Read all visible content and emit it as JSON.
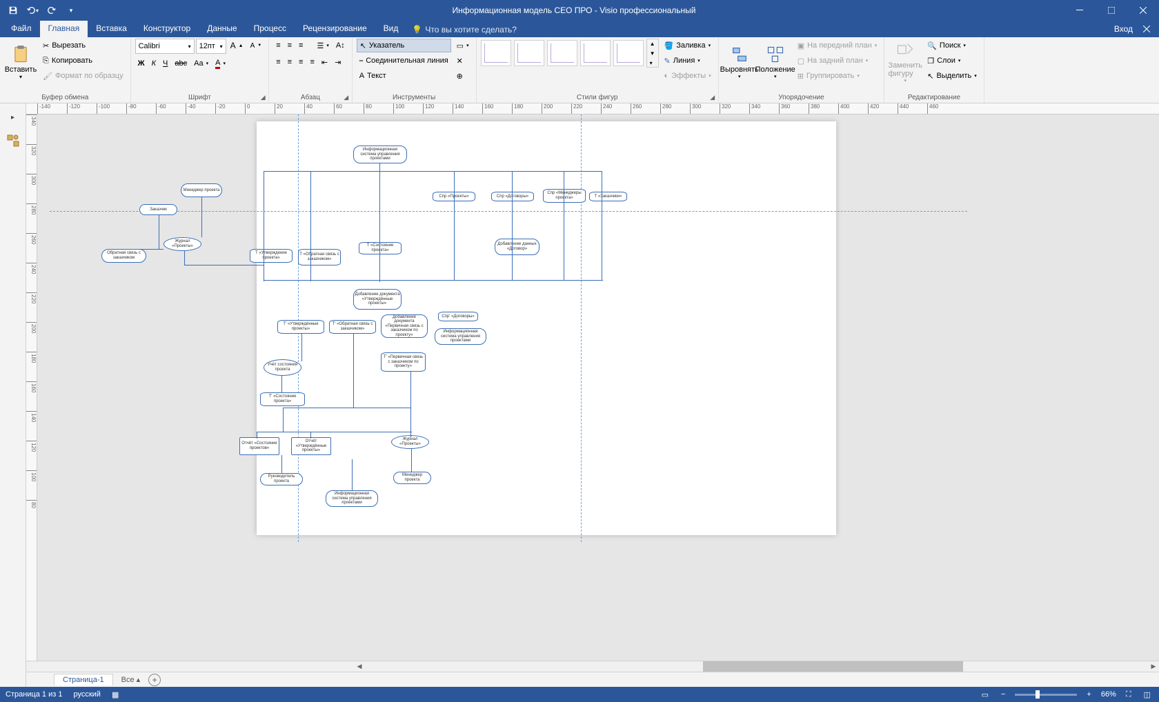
{
  "app": {
    "title": "Информационная модель СЕО ПРО - Visio профессиональный"
  },
  "qat": {
    "save": "save",
    "undo": "undo",
    "redo": "redo",
    "more": "more"
  },
  "tabs": {
    "file": "Файл",
    "home": "Главная",
    "insert": "Вставка",
    "design": "Конструктор",
    "data": "Данные",
    "process": "Процесс",
    "review": "Рецензирование",
    "view": "Вид",
    "login": "Вход",
    "tell_me": "Что вы хотите сделать?"
  },
  "ribbon": {
    "clipboard": {
      "label": "Буфер обмена",
      "paste": "Вставить",
      "cut": "Вырезать",
      "copy": "Копировать",
      "format_painter": "Формат по образцу"
    },
    "font": {
      "label": "Шрифт",
      "family": "Calibri",
      "size": "12пт",
      "bold": "Ж",
      "italic": "К",
      "underline": "Ч",
      "strike": "abc",
      "case": "Aa"
    },
    "paragraph": {
      "label": "Абзац"
    },
    "tools": {
      "label": "Инструменты",
      "pointer": "Указатель",
      "connector": "Соединительная линия",
      "text": "Текст"
    },
    "shape_styles": {
      "label": "Стили фигур",
      "fill": "Заливка",
      "line": "Линия",
      "effects": "Эффекты"
    },
    "arrange": {
      "label": "Упорядочение",
      "align": "Выровнять",
      "position": "Положение",
      "bring_front": "На передний план",
      "send_back": "На задний план",
      "group": "Группировать",
      "change_shape": "Заменить фигуру"
    },
    "editing": {
      "label": "Редактирование",
      "find": "Поиск",
      "layers": "Слои",
      "select": "Выделить"
    }
  },
  "ruler_h": [
    "-140",
    "-120",
    "-100",
    "-80",
    "-60",
    "-40",
    "-20",
    "0",
    "20",
    "40",
    "60",
    "80",
    "100",
    "120",
    "140",
    "160",
    "180",
    "200",
    "220",
    "240",
    "260",
    "280",
    "300",
    "320",
    "340",
    "360",
    "380",
    "400",
    "420",
    "440",
    "460"
  ],
  "ruler_v": [
    "340",
    "320",
    "300",
    "280",
    "260",
    "240",
    "220",
    "200",
    "180",
    "160",
    "140",
    "120",
    "100",
    "80"
  ],
  "diagram": {
    "shapes": {
      "s1": "Информационная система управления проектами",
      "s2": "Менеджер проекта",
      "s3": "Заказчик",
      "s4": "Обратная связь с заказчиком",
      "s5": "Журнал «Проекты»",
      "s6": "Т «Утверждение проекта»",
      "s7": "Т «Обратная связь с заказчиком»",
      "s8": "Т «Состояние проекта»",
      "s9": "Спр «Проекты»",
      "s10": "Спр «Договоры»",
      "s11": "Спр «Менеджеры проекта»",
      "s12": "Т «Заказчики»",
      "s13": "Добавление данных «Договор»",
      "s14": "Добавление документа «Утверждённые проекты»",
      "s15": "Т' «Утверждённые проекты»",
      "s16": "Т' «Обратная связь с заказчиком»",
      "s17": "Добавление документа «Первичная связь с заказчиком по проекту»",
      "s18": "Спр' «Договоры»",
      "s19": "Информационная система управления проектами",
      "s20": "Учёт состояния проекта",
      "s21": "Т' «Первичная связь с заказчиком по проекту»",
      "s22": "Т' «Состояние проекта»",
      "s23": "Отчёт «Состояние проектов»",
      "s24": "Отчёт «Утверждённые проекты»",
      "s25": "Руководитель проекта",
      "s26": "Журнал «Проекты»",
      "s27": "Менеджер проекта",
      "s28": "Информационная система управления проектами"
    }
  },
  "pages": {
    "page1": "Страница-1",
    "all": "Все"
  },
  "status": {
    "page_counter": "Страница 1 из 1",
    "language": "русский",
    "zoom": "66%"
  }
}
